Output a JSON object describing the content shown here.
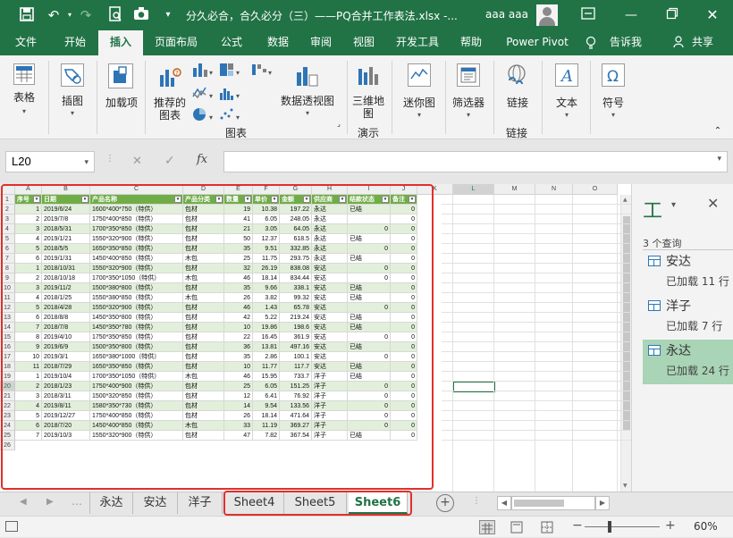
{
  "title_bar": {
    "title": "分久必合，合久必分（三）——PQ合并工作表法.xlsx  -...",
    "user": "aaa aaa",
    "undo_icon": "undo-icon",
    "redo_icon": "redo-icon"
  },
  "ribbon_tabs": [
    "文件",
    "开始",
    "插入",
    "页面布局",
    "公式",
    "数据",
    "审阅",
    "视图",
    "开发工具",
    "帮助",
    "Power Pivot",
    "告诉我",
    "共享"
  ],
  "ribbon": {
    "table": "表格",
    "illustrations": "插图",
    "addins": "加载项",
    "recommended_charts": "推荐的图表",
    "pivot_chart": "数据透视图",
    "charts_group": "图表",
    "map3d": "三维地图",
    "tours_group": "演示",
    "sparklines": "迷你图",
    "filters": "筛选器",
    "link": "链接",
    "links_group": "链接",
    "text": "文本",
    "symbols": "符号"
  },
  "formula_bar": {
    "name_box": "L20",
    "fx": "fx",
    "formula": ""
  },
  "grid": {
    "columns": [
      "A",
      "B",
      "C",
      "D",
      "E",
      "F",
      "G",
      "H",
      "I",
      "J",
      "K",
      "L",
      "M",
      "N",
      "O"
    ],
    "table_headers": [
      "序号",
      "日期",
      "产品名称",
      "产品分类",
      "数量",
      "单价",
      "金额",
      "供应商",
      "结款状态",
      "备注"
    ],
    "rows": [
      [
        "1",
        "2019/6/24",
        "1600*400*750（特供）",
        "包材",
        "19",
        "10.38",
        "197.22",
        "永达",
        "已结",
        "0"
      ],
      [
        "2",
        "2019/7/8",
        "1750*400*850（特供）",
        "包材",
        "41",
        "6.05",
        "248.05",
        "永达",
        "",
        "0"
      ],
      [
        "3",
        "2018/5/31",
        "1700*350*850（特供）",
        "包材",
        "21",
        "3.05",
        "64.05",
        "永达",
        "0",
        "0"
      ],
      [
        "4",
        "2019/1/21",
        "1550*320*900（特供）",
        "包材",
        "50",
        "12.37",
        "618.5",
        "永达",
        "已结",
        "0"
      ],
      [
        "5",
        "2018/5/5",
        "1650*350*850（特供）",
        "包材",
        "35",
        "9.51",
        "332.85",
        "永达",
        "0",
        "0"
      ],
      [
        "6",
        "2019/1/31",
        "1450*400*850（特供）",
        "木包",
        "25",
        "11.75",
        "293.75",
        "永达",
        "已结",
        "0"
      ],
      [
        "1",
        "2018/10/31",
        "1550*320*900（特供）",
        "包材",
        "32",
        "26.19",
        "838.08",
        "安达",
        "0",
        "0"
      ],
      [
        "2",
        "2018/10/18",
        "1700*350*1050（特供）",
        "木包",
        "46",
        "18.14",
        "834.44",
        "安达",
        "0",
        "0"
      ],
      [
        "3",
        "2019/11/2",
        "1500*380*800（特供）",
        "包材",
        "35",
        "9.66",
        "338.1",
        "安达",
        "已结",
        "0"
      ],
      [
        "4",
        "2018/1/25",
        "1550*380*850（特供）",
        "木包",
        "26",
        "3.82",
        "99.32",
        "安达",
        "已结",
        "0"
      ],
      [
        "5",
        "2018/4/28",
        "1550*320*900（特供）",
        "包材",
        "46",
        "1.43",
        "65.78",
        "安达",
        "0",
        "0"
      ],
      [
        "6",
        "2018/8/8",
        "1450*350*800（特供）",
        "包材",
        "42",
        "5.22",
        "219.24",
        "安达",
        "已结",
        "0"
      ],
      [
        "7",
        "2018/7/8",
        "1450*350*780（特供）",
        "包材",
        "10",
        "19.86",
        "198.6",
        "安达",
        "已结",
        "0"
      ],
      [
        "8",
        "2019/4/10",
        "1750*350*850（特供）",
        "包材",
        "22",
        "16.45",
        "361.9",
        "安达",
        "0",
        "0"
      ],
      [
        "9",
        "2019/6/9",
        "1500*350*800（特供）",
        "包材",
        "36",
        "13.81",
        "497.16",
        "安达",
        "已结",
        "0"
      ],
      [
        "10",
        "2019/3/1",
        "1650*380*1000（特供）",
        "包材",
        "35",
        "2.86",
        "100.1",
        "安达",
        "0",
        "0"
      ],
      [
        "11",
        "2018/7/29",
        "1650*350*850（特供）",
        "包材",
        "10",
        "11.77",
        "117.7",
        "安达",
        "已结",
        "0"
      ],
      [
        "1",
        "2019/10/4",
        "1700*350*1050（特供）",
        "木包",
        "46",
        "15.95",
        "733.7",
        "洋子",
        "已结",
        "0"
      ],
      [
        "2",
        "2018/1/23",
        "1750*400*900（特供）",
        "包材",
        "25",
        "6.05",
        "151.25",
        "洋子",
        "0",
        "0"
      ],
      [
        "3",
        "2018/3/11",
        "1500*320*850（特供）",
        "包材",
        "12",
        "6.41",
        "76.92",
        "洋子",
        "0",
        "0"
      ],
      [
        "4",
        "2019/8/11",
        "1580*350*730（特供）",
        "包材",
        "14",
        "9.54",
        "133.56",
        "洋子",
        "0",
        "0"
      ],
      [
        "5",
        "2019/12/27",
        "1750*400*850（特供）",
        "包材",
        "26",
        "18.14",
        "471.64",
        "洋子",
        "0",
        "0"
      ],
      [
        "6",
        "2018/7/20",
        "1450*400*850（特供）",
        "木包",
        "33",
        "11.19",
        "369.27",
        "洋子",
        "0",
        "0"
      ],
      [
        "7",
        "2019/10/3",
        "1550*320*900（特供）",
        "包材",
        "47",
        "7.82",
        "367.54",
        "洋子",
        "已结",
        "0"
      ]
    ]
  },
  "queries_pane": {
    "title": "工",
    "count": "3 个查询",
    "items": [
      {
        "name": "安达",
        "status": "已加载 11 行"
      },
      {
        "name": "洋子",
        "status": "已加载 7 行"
      },
      {
        "name": "永达",
        "status": "已加载 24 行"
      }
    ]
  },
  "sheet_tabs": [
    "永达",
    "安达",
    "洋子",
    "Sheet4",
    "Sheet5",
    "Sheet6"
  ],
  "active_sheet": "Sheet6",
  "status_bar": {
    "zoom": "60%"
  },
  "colors": {
    "excel_green": "#217346",
    "table_header": "#70ad47",
    "band": "#e2efda",
    "highlight": "#e0302c"
  }
}
